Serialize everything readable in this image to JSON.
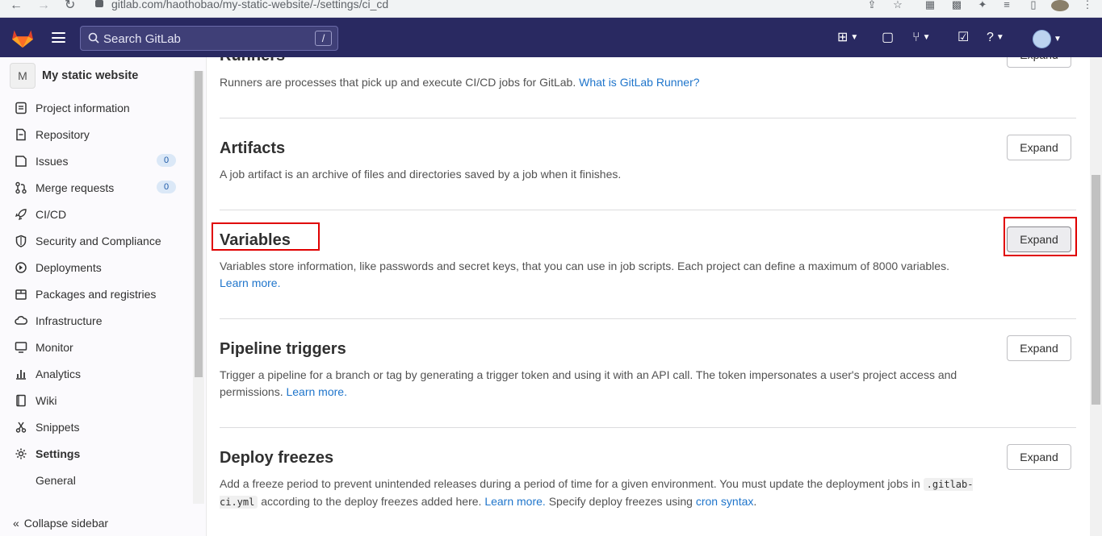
{
  "browser": {
    "url": "gitlab.com/haothobao/my-static-website/-/settings/ci_cd"
  },
  "topnav": {
    "search_placeholder": "Search GitLab",
    "search_shortcut": "/"
  },
  "sidebar": {
    "project_initial": "M",
    "project_name": "My static website",
    "items": [
      {
        "label": "Project information",
        "icon": "info-icon"
      },
      {
        "label": "Repository",
        "icon": "doc-icon"
      },
      {
        "label": "Issues",
        "icon": "issues-icon",
        "badge": "0"
      },
      {
        "label": "Merge requests",
        "icon": "merge-request-icon",
        "badge": "0"
      },
      {
        "label": "CI/CD",
        "icon": "rocket-icon"
      },
      {
        "label": "Security and Compliance",
        "icon": "shield-icon"
      },
      {
        "label": "Deployments",
        "icon": "deployments-icon"
      },
      {
        "label": "Packages and registries",
        "icon": "package-icon"
      },
      {
        "label": "Infrastructure",
        "icon": "cloud-icon"
      },
      {
        "label": "Monitor",
        "icon": "monitor-icon"
      },
      {
        "label": "Analytics",
        "icon": "chart-icon"
      },
      {
        "label": "Wiki",
        "icon": "book-icon"
      },
      {
        "label": "Snippets",
        "icon": "scissors-icon"
      },
      {
        "label": "Settings",
        "icon": "gear-icon"
      }
    ],
    "sub_general": "General",
    "collapse_label": "Collapse sidebar"
  },
  "sections": {
    "runners": {
      "title": "Runners",
      "desc": "Runners are processes that pick up and execute CI/CD jobs for GitLab.",
      "link": "What is GitLab Runner?",
      "button": "Expand"
    },
    "artifacts": {
      "title": "Artifacts",
      "desc": "A job artifact is an archive of files and directories saved by a job when it finishes.",
      "button": "Expand"
    },
    "variables": {
      "title": "Variables",
      "desc": "Variables store information, like passwords and secret keys, that you can use in job scripts. Each project can define a maximum of 8000 variables.",
      "link": "Learn more.",
      "button": "Expand"
    },
    "pipeline_triggers": {
      "title": "Pipeline triggers",
      "desc": "Trigger a pipeline for a branch or tag by generating a trigger token and using it with an API call. The token impersonates a user's project access and permissions.",
      "link": "Learn more.",
      "button": "Expand"
    },
    "deploy_freezes": {
      "title": "Deploy freezes",
      "desc_1": "Add a freeze period to prevent unintended releases during a period of time for a given environment. You must update the deployment jobs in",
      "code": ".gitlab-ci.yml",
      "desc_2": "according to the deploy freezes added here.",
      "link": "Learn more.",
      "desc_3": "Specify deploy freezes using",
      "link2": "cron syntax",
      "desc_4": ".",
      "button": "Expand"
    }
  },
  "colors": {
    "topnav_bg": "#292961",
    "link": "#1f75cb",
    "highlight": "#e00000"
  }
}
